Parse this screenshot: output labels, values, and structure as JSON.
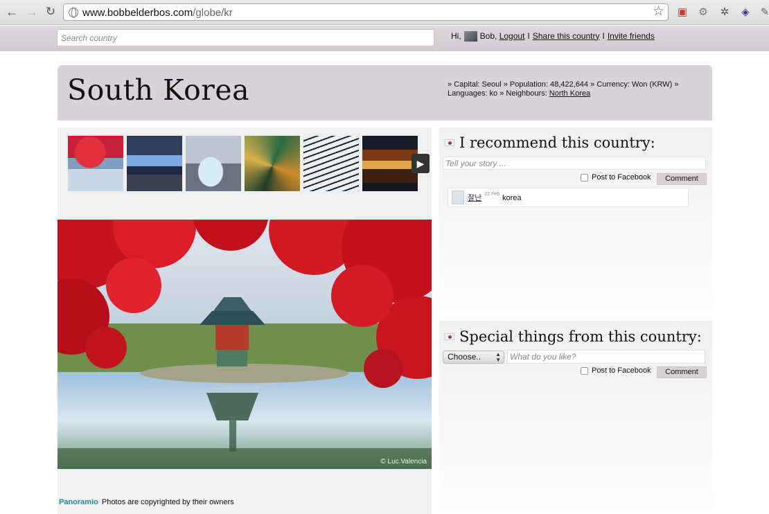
{
  "browser": {
    "url_host": "www.bobbelderbos.com",
    "url_path": "/globe/kr"
  },
  "topbar": {
    "search_placeholder": "Search country",
    "greeting": "Hi,",
    "user_name": "Bob,",
    "logout": "Logout",
    "separator": "I",
    "share": "Share this country",
    "invite": "Invite friends"
  },
  "header": {
    "title": "South Korea",
    "facts_text": "» Capital: Seoul » Population: 48,422,644 » Currency: Won (KRW) » Languages: ko » Neighbours:",
    "neighbour": "North Korea"
  },
  "gallery": {
    "next_icon": "▶",
    "photo_copyright": "© Luc.Valencia",
    "credit_logo": "Panoramio",
    "credit_text": "Photos are copyrighted by their owners"
  },
  "recommend": {
    "title": "I recommend this country:",
    "story_placeholder": "Tell your story ...",
    "post_fb": "Post to Facebook",
    "comment_button": "Comment",
    "comments": [
      {
        "author": "잘난",
        "date": "22 Feb",
        "text": "korea"
      }
    ]
  },
  "special": {
    "title": "Special things from this country:",
    "select_value": "Choose..",
    "like_placeholder": "What do you like?",
    "post_fb": "Post to Facebook",
    "comment_button": "Comment"
  }
}
